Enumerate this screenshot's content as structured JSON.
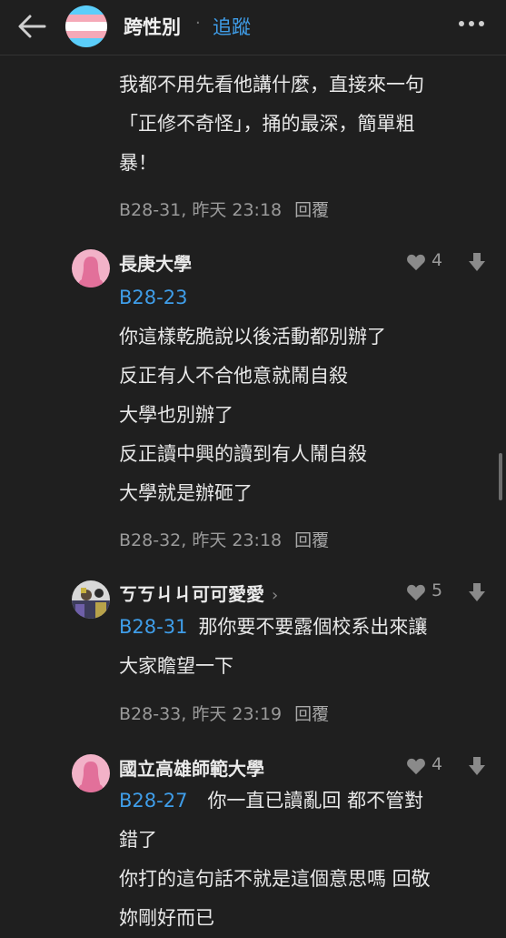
{
  "header": {
    "forum_title": "跨性別",
    "separator": "·",
    "follow_label": "追蹤"
  },
  "colors": {
    "background": "#1f1f1f",
    "accent_blue": "#3f9de8",
    "flag_blue": "#5bcefa",
    "flag_pink": "#f5a9b8",
    "avatar_pink": "#f2b2c8"
  },
  "comments": [
    {
      "lines": [
        "我都不用先看他講什麼，直接來一句",
        "「正修不奇怪」，捅的最深，簡單粗",
        "暴！"
      ],
      "meta": "B28-31, 昨天 23:18",
      "reply_label": "回覆"
    },
    {
      "author": "長庚大學",
      "likes": "4",
      "reply_tag": "B28-23",
      "lines": [
        "你這樣乾脆說以後活動都別辦了",
        "反正有人不合他意就鬧自殺",
        "大學也別辦了",
        "反正讀中興的讀到有人鬧自殺",
        "大學就是辦砸了"
      ],
      "meta": "B28-32, 昨天 23:18",
      "reply_label": "回覆"
    },
    {
      "author": "ㄎㄎㄐㄐ可可愛愛",
      "likes": "5",
      "reply_tag": "B28-31",
      "lines": [
        "那你要不要露個校系出來讓",
        "大家瞻望一下"
      ],
      "meta": "B28-33, 昨天 23:19",
      "reply_label": "回覆"
    },
    {
      "author": "國立高雄師範大學",
      "likes": "4",
      "reply_tag": "B28-27",
      "lines": [
        "你一直已讀亂回 都不管對",
        "錯了",
        "你打的這句話不就是這個意思嗎 回敬",
        "妳剛好而已"
      ]
    }
  ]
}
